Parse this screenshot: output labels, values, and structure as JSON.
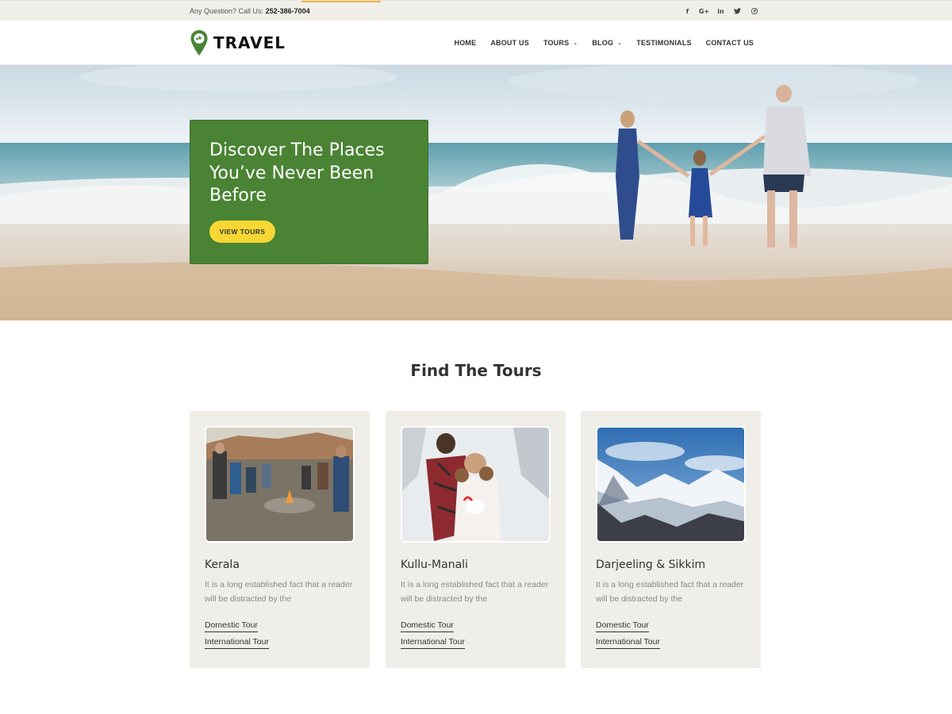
{
  "topbar": {
    "contact_label": "Any Question? Call Us:",
    "phone": "252-386-7004",
    "social": [
      {
        "icon": "facebook-icon",
        "glyph": "f"
      },
      {
        "icon": "google-plus-icon",
        "glyph": "G+"
      },
      {
        "icon": "linkedin-icon",
        "glyph": "in"
      },
      {
        "icon": "twitter-icon",
        "glyph": "🐦"
      },
      {
        "icon": "pinterest-icon",
        "glyph": "℗"
      }
    ]
  },
  "header": {
    "logo_text": "TRAVEL",
    "nav": [
      {
        "label": "HOME",
        "dropdown": false
      },
      {
        "label": "ABOUT US",
        "dropdown": false
      },
      {
        "label": "TOURS",
        "dropdown": true
      },
      {
        "label": "BLOG",
        "dropdown": true
      },
      {
        "label": "TESTIMONIALS",
        "dropdown": false
      },
      {
        "label": "CONTACT US",
        "dropdown": false
      }
    ]
  },
  "hero": {
    "title": "Discover The Places You’ve Never Been Before",
    "button_label": "VIEW TOURS"
  },
  "tours": {
    "title": "Find The Tours",
    "cards": [
      {
        "title": "Kerala",
        "text": "It is a long established fact that a reader will be distracted by the",
        "link1": "Domestic Tour",
        "link2": "International Tour"
      },
      {
        "title": "Kullu-Manali",
        "text": "It is a long established fact that a reader will be distracted by the",
        "link1": "Domestic Tour",
        "link2": "International Tour"
      },
      {
        "title": "Darjeeling & Sikkim",
        "text": "It is a long established fact that a reader will be distracted by the",
        "link1": "Domestic Tour",
        "link2": "International Tour"
      }
    ]
  },
  "colors": {
    "brand_green": "#4a8334",
    "button_yellow": "#f6d733",
    "topbar_bg": "#f1efe9",
    "card_bg": "#f0eee8"
  }
}
